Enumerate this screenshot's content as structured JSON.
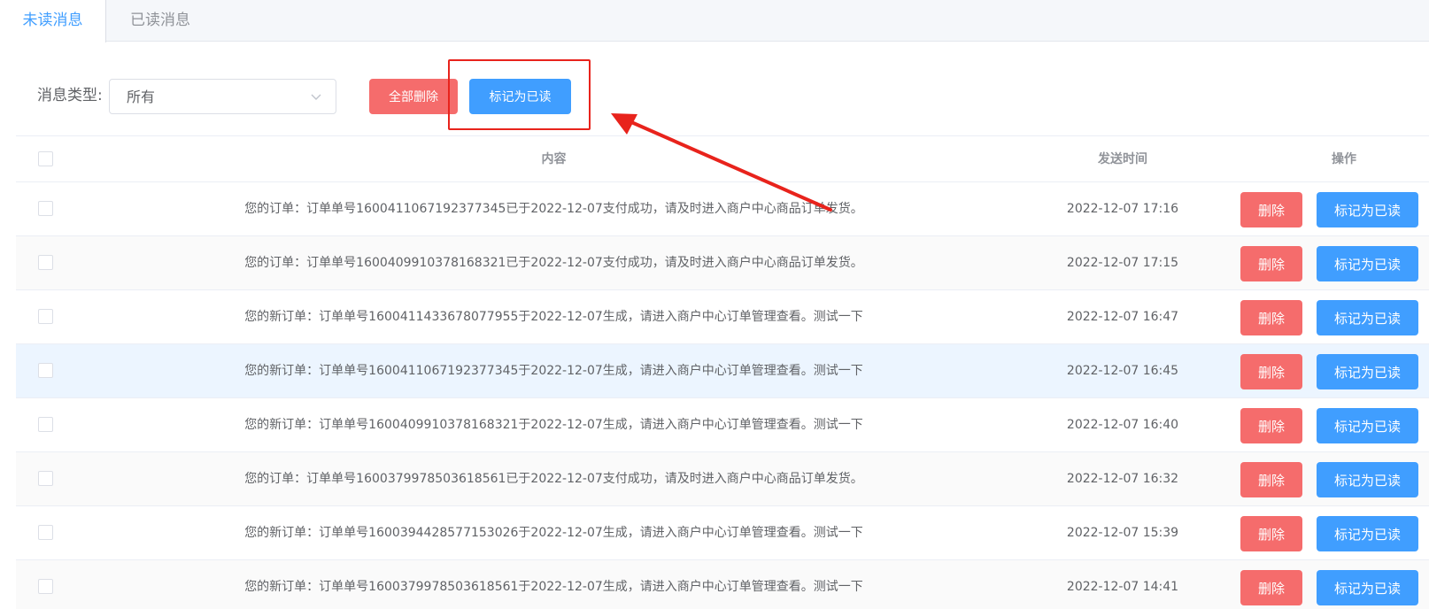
{
  "tabs": [
    {
      "label": "未读消息",
      "active": true
    },
    {
      "label": "已读消息",
      "active": false
    }
  ],
  "filter": {
    "label": "消息类型:",
    "selected": "所有"
  },
  "toolbar": {
    "delete_all_label": "全部删除",
    "mark_all_read_label": "标记为已读"
  },
  "table": {
    "headers": {
      "content": "内容",
      "time": "发送时间",
      "actions": "操作"
    },
    "rows": [
      {
        "content": "您的订单：订单单号1600411067192377345已于2022-12-07支付成功，请及时进入商户中心商品订单发货。",
        "time": "2022-12-07 17:16",
        "delete_label": "删除",
        "mark_label": "标记为已读"
      },
      {
        "content": "您的订单：订单单号1600409910378168321已于2022-12-07支付成功，请及时进入商户中心商品订单发货。",
        "time": "2022-12-07 17:15",
        "delete_label": "删除",
        "mark_label": "标记为已读"
      },
      {
        "content": "您的新订单：订单单号1600411433678077955于2022-12-07生成，请进入商户中心订单管理查看。测试一下",
        "time": "2022-12-07 16:47",
        "delete_label": "删除",
        "mark_label": "标记为已读"
      },
      {
        "content": "您的新订单：订单单号1600411067192377345于2022-12-07生成，请进入商户中心订单管理查看。测试一下",
        "time": "2022-12-07 16:45",
        "delete_label": "删除",
        "mark_label": "标记为已读"
      },
      {
        "content": "您的新订单：订单单号1600409910378168321于2022-12-07生成，请进入商户中心订单管理查看。测试一下",
        "time": "2022-12-07 16:40",
        "delete_label": "删除",
        "mark_label": "标记为已读"
      },
      {
        "content": "您的订单：订单单号1600379978503618561已于2022-12-07支付成功，请及时进入商户中心商品订单发货。",
        "time": "2022-12-07 16:32",
        "delete_label": "删除",
        "mark_label": "标记为已读"
      },
      {
        "content": "您的新订单：订单单号1600394428577153026于2022-12-07生成，请进入商户中心订单管理查看。测试一下",
        "time": "2022-12-07 15:39",
        "delete_label": "删除",
        "mark_label": "标记为已读"
      },
      {
        "content": "您的新订单：订单单号1600379978503618561于2022-12-07生成，请进入商户中心订单管理查看。测试一下",
        "time": "2022-12-07 14:41",
        "delete_label": "删除",
        "mark_label": "标记为已读"
      }
    ]
  },
  "colors": {
    "primary": "#409eff",
    "danger": "#f56c6c",
    "annotation": "#e8231c"
  },
  "icons": {
    "select_arrow": "chevron-down-icon"
  }
}
